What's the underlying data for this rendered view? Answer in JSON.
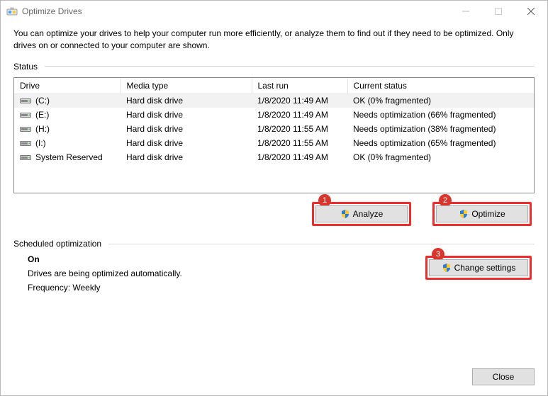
{
  "window": {
    "title": "Optimize Drives"
  },
  "description": "You can optimize your drives to help your computer run more efficiently, or analyze them to find out if they need to be optimized. Only drives on or connected to your computer are shown.",
  "status": {
    "label": "Status",
    "columns": {
      "drive": "Drive",
      "media": "Media type",
      "last": "Last run",
      "current": "Current status"
    },
    "rows": [
      {
        "drive": "(C:)",
        "media": "Hard disk drive",
        "last": "1/8/2020 11:49 AM",
        "status": "OK (0% fragmented)",
        "selected": true
      },
      {
        "drive": "(E:)",
        "media": "Hard disk drive",
        "last": "1/8/2020 11:49 AM",
        "status": "Needs optimization (66% fragmented)",
        "selected": false
      },
      {
        "drive": "(H:)",
        "media": "Hard disk drive",
        "last": "1/8/2020 11:55 AM",
        "status": "Needs optimization (38% fragmented)",
        "selected": false
      },
      {
        "drive": "(I:)",
        "media": "Hard disk drive",
        "last": "1/8/2020 11:55 AM",
        "status": "Needs optimization (65% fragmented)",
        "selected": false
      },
      {
        "drive": "System Reserved",
        "media": "Hard disk drive",
        "last": "1/8/2020 11:49 AM",
        "status": "OK (0% fragmented)",
        "selected": false
      }
    ]
  },
  "buttons": {
    "analyze": "Analyze",
    "optimize": "Optimize",
    "change_settings": "Change settings",
    "close": "Close"
  },
  "annotations": {
    "badge1": "1",
    "badge2": "2",
    "badge3": "3"
  },
  "scheduled": {
    "label": "Scheduled optimization",
    "status": "On",
    "description": "Drives are being optimized automatically.",
    "frequency": "Frequency: Weekly"
  }
}
